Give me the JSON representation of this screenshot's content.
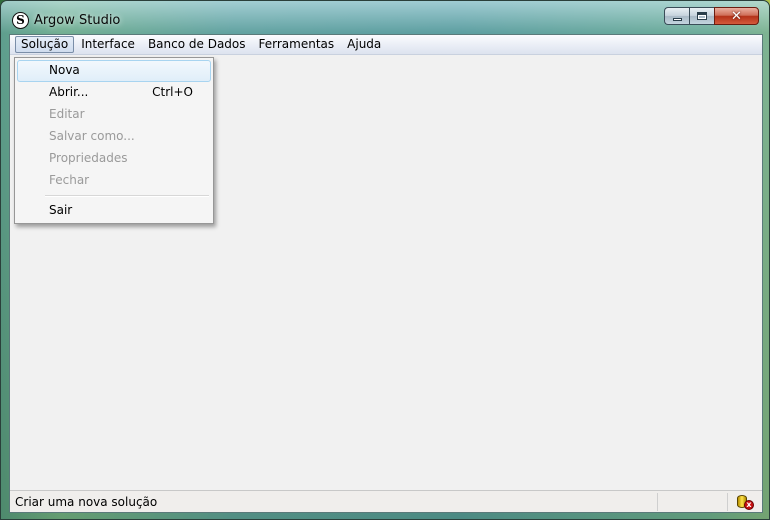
{
  "window": {
    "title": "Argow Studio",
    "icon_letter": "S",
    "icon": "app-logo-icon"
  },
  "caption_buttons": {
    "minimize_icon": "minimize-icon",
    "maximize_icon": "maximize-icon",
    "close_icon": "close-icon",
    "close_glyph": "✕"
  },
  "menubar": {
    "items": [
      {
        "label": "Solução",
        "open": true
      },
      {
        "label": "Interface"
      },
      {
        "label": "Banco de Dados"
      },
      {
        "label": "Ferramentas"
      },
      {
        "label": "Ajuda"
      }
    ]
  },
  "dropdown": {
    "items": [
      {
        "label": "Nova",
        "state": "highlighted"
      },
      {
        "label": "Abrir...",
        "shortcut": "Ctrl+O"
      },
      {
        "label": "Editar",
        "state": "disabled"
      },
      {
        "label": "Salvar como...",
        "state": "disabled"
      },
      {
        "label": "Propriedades",
        "state": "disabled"
      },
      {
        "label": "Fechar",
        "state": "disabled"
      },
      {
        "label": "Sair"
      }
    ]
  },
  "statusbar": {
    "text": "Criar uma nova solução",
    "icon": "database-disconnected-icon",
    "icon_badge": "x"
  },
  "colors": {
    "client_bg": "#f1f1f1",
    "highlight_border": "#a8d4f0",
    "disabled_text": "#9a9a9a"
  }
}
